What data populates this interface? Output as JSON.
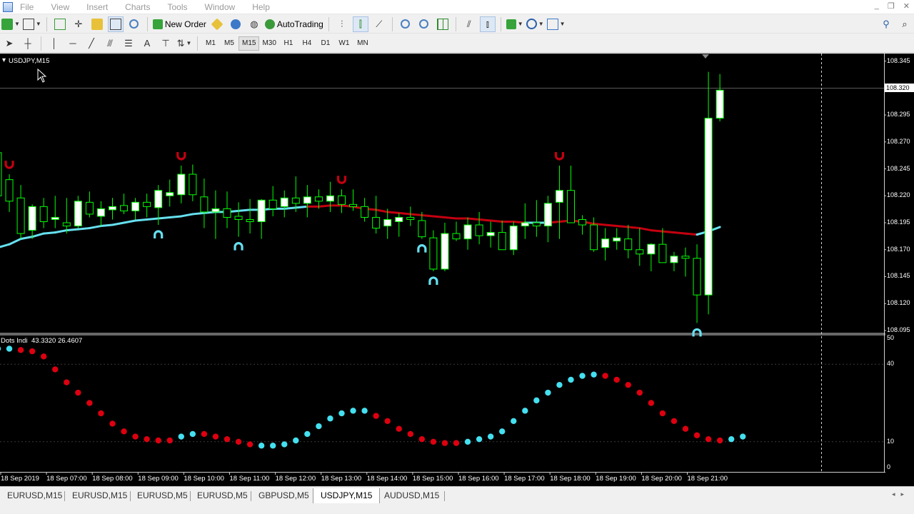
{
  "menu": {
    "items": [
      "File",
      "View",
      "Insert",
      "Charts",
      "Tools",
      "Window",
      "Help"
    ]
  },
  "toolbar": {
    "new_order_label": "New Order",
    "autotrading_label": "AutoTrading",
    "timeframes": [
      "M1",
      "M5",
      "M15",
      "M30",
      "H1",
      "H4",
      "D1",
      "W1",
      "MN"
    ],
    "active_timeframe": "M15"
  },
  "chart": {
    "symbol_label": "USDJPY,M15",
    "current_price": "108.320",
    "price_ticks": [
      "108.345",
      "108.295",
      "108.270",
      "108.245",
      "108.220",
      "108.195",
      "108.170",
      "108.145",
      "108.120",
      "108.095"
    ],
    "indicator_label": "Dots Indi",
    "indicator_values": "43.3320 26.4607",
    "indicator_ticks": [
      "50",
      "40",
      "10",
      "0"
    ],
    "time_ticks": [
      "18 Sep 2019",
      "18 Sep 07:00",
      "18 Sep 08:00",
      "18 Sep 09:00",
      "18 Sep 10:00",
      "18 Sep 11:00",
      "18 Sep 12:00",
      "18 Sep 13:00",
      "18 Sep 14:00",
      "18 Sep 15:00",
      "18 Sep 16:00",
      "18 Sep 17:00",
      "18 Sep 18:00",
      "18 Sep 19:00",
      "18 Sep 20:00",
      "18 Sep 21:00"
    ],
    "colors": {
      "background": "#000000",
      "bull_body": "#ffffff",
      "bear_body": "#000000",
      "candle_wick": "#00ff00",
      "ma_up": "#66e0f0",
      "ma_down": "#c40010",
      "dot_up": "#44e0f0",
      "dot_down": "#dd0010",
      "grid": "#2a4a4a"
    }
  },
  "chart_data": [
    {
      "type": "candlestick",
      "symbol": "USDJPY",
      "timeframe": "M15",
      "ylim": [
        108.093,
        108.352
      ],
      "candles": [
        [
          108.26,
          108.275,
          108.21,
          108.22
        ],
        [
          108.235,
          108.24,
          108.205,
          108.215
        ],
        [
          108.218,
          108.23,
          108.18,
          108.185
        ],
        [
          108.188,
          108.212,
          108.18,
          108.21
        ],
        [
          108.21,
          108.218,
          108.19,
          108.196
        ],
        [
          108.198,
          108.22,
          108.19,
          108.2
        ],
        [
          108.195,
          108.218,
          108.185,
          108.192
        ],
        [
          108.192,
          108.22,
          108.19,
          108.215
        ],
        [
          108.214,
          108.224,
          108.2,
          108.203
        ],
        [
          108.201,
          108.215,
          108.192,
          108.208
        ],
        [
          108.207,
          108.218,
          108.198,
          108.21
        ],
        [
          108.211,
          108.222,
          108.203,
          108.206
        ],
        [
          108.206,
          108.218,
          108.198,
          108.214
        ],
        [
          108.214,
          108.222,
          108.2,
          108.21
        ],
        [
          108.209,
          108.23,
          108.193,
          108.225
        ],
        [
          108.22,
          108.235,
          108.21,
          108.223
        ],
        [
          108.221,
          108.248,
          108.213,
          108.24
        ],
        [
          108.24,
          108.249,
          108.215,
          108.221
        ],
        [
          108.219,
          108.236,
          108.19,
          108.205
        ],
        [
          108.205,
          108.225,
          108.18,
          108.208
        ],
        [
          108.208,
          108.224,
          108.19,
          108.2
        ],
        [
          108.201,
          108.214,
          108.182,
          108.198
        ],
        [
          108.198,
          108.217,
          108.185,
          108.196
        ],
        [
          108.196,
          108.217,
          108.18,
          108.216
        ],
        [
          108.216,
          108.229,
          108.201,
          108.208
        ],
        [
          108.21,
          108.225,
          108.2,
          108.218
        ],
        [
          108.218,
          108.238,
          108.205,
          108.213
        ],
        [
          108.213,
          108.23,
          108.2,
          108.219
        ],
        [
          108.219,
          108.226,
          108.208,
          108.215
        ],
        [
          108.215,
          108.233,
          108.205,
          108.22
        ],
        [
          108.22,
          108.226,
          108.204,
          108.212
        ],
        [
          108.212,
          108.226,
          108.206,
          108.21
        ],
        [
          108.21,
          108.218,
          108.196,
          108.2
        ],
        [
          108.2,
          108.22,
          108.185,
          108.19
        ],
        [
          108.192,
          108.208,
          108.18,
          108.198
        ],
        [
          108.196,
          108.204,
          108.182,
          108.2
        ],
        [
          108.2,
          108.21,
          108.192,
          108.198
        ],
        [
          108.197,
          108.205,
          108.18,
          108.182
        ],
        [
          108.181,
          108.188,
          108.15,
          108.152
        ],
        [
          108.152,
          108.195,
          108.15,
          108.185
        ],
        [
          108.185,
          108.196,
          108.178,
          108.18
        ],
        [
          108.18,
          108.2,
          108.17,
          108.193
        ],
        [
          108.193,
          108.205,
          108.175,
          108.183
        ],
        [
          108.183,
          108.196,
          108.172,
          108.186
        ],
        [
          108.186,
          108.197,
          108.177,
          108.17
        ],
        [
          108.17,
          108.196,
          108.165,
          108.192
        ],
        [
          108.192,
          108.213,
          108.18,
          108.195
        ],
        [
          108.195,
          108.216,
          108.182,
          108.192
        ],
        [
          108.192,
          108.22,
          108.177,
          108.213
        ],
        [
          108.214,
          108.248,
          108.18,
          108.225
        ],
        [
          108.225,
          108.248,
          108.202,
          108.195
        ],
        [
          108.198,
          108.202,
          108.184,
          108.193
        ],
        [
          108.193,
          108.2,
          108.168,
          108.17
        ],
        [
          108.172,
          108.19,
          108.16,
          108.18
        ],
        [
          108.178,
          108.19,
          108.17,
          108.181
        ],
        [
          108.18,
          108.193,
          108.162,
          108.17
        ],
        [
          108.17,
          108.19,
          108.155,
          108.166
        ],
        [
          108.166,
          108.176,
          108.15,
          108.175
        ],
        [
          108.175,
          108.19,
          108.158,
          108.158
        ],
        [
          108.158,
          108.168,
          108.15,
          108.164
        ],
        [
          108.164,
          108.172,
          108.145,
          108.162
        ],
        [
          108.162,
          108.175,
          108.102,
          108.128
        ],
        [
          108.128,
          108.335,
          108.11,
          108.292
        ],
        [
          108.292,
          108.333,
          108.289,
          108.318
        ]
      ],
      "ma_line": [
        108.172,
        108.175,
        108.18,
        108.182,
        108.185,
        108.186,
        108.188,
        108.189,
        108.19,
        108.192,
        108.193,
        108.195,
        108.197,
        108.198,
        108.199,
        108.2,
        108.201,
        108.203,
        108.204,
        108.205,
        108.205,
        108.206,
        108.207,
        108.207,
        108.208,
        108.208,
        108.209,
        108.21,
        108.21,
        108.211,
        108.211,
        108.21,
        108.208,
        108.207,
        108.205,
        108.204,
        108.203,
        108.202,
        108.201,
        108.2,
        108.199,
        108.199,
        108.198,
        108.197,
        108.196,
        108.196,
        108.195,
        108.195,
        108.195,
        108.196,
        108.197,
        108.196,
        108.194,
        108.193,
        108.192,
        108.191,
        108.19,
        108.188,
        108.187,
        108.186,
        108.185,
        108.184,
        108.187,
        108.191
      ],
      "ma_trend": [
        "up",
        "up",
        "up",
        "up",
        "up",
        "up",
        "up",
        "up",
        "up",
        "up",
        "up",
        "up",
        "up",
        "up",
        "up",
        "up",
        "up",
        "up",
        "up",
        "up",
        "up",
        "up",
        "up",
        "up",
        "up",
        "up",
        "up",
        "up",
        "down",
        "down",
        "down",
        "down",
        "down",
        "down",
        "down",
        "down",
        "down",
        "down",
        "down",
        "down",
        "down",
        "down",
        "down",
        "down",
        "down",
        "down",
        "down",
        "up",
        "up",
        "down",
        "down",
        "down",
        "down",
        "down",
        "down",
        "down",
        "down",
        "down",
        "down",
        "down",
        "down",
        "down",
        "up",
        "up"
      ],
      "signals": [
        {
          "candle": 1,
          "kind": "down"
        },
        {
          "candle": 14,
          "kind": "up"
        },
        {
          "candle": 16,
          "kind": "down"
        },
        {
          "candle": 21,
          "kind": "up"
        },
        {
          "candle": 30,
          "kind": "down"
        },
        {
          "candle": 37,
          "kind": "up"
        },
        {
          "candle": 38,
          "kind": "up"
        },
        {
          "candle": 49,
          "kind": "down"
        },
        {
          "candle": 61,
          "kind": "up"
        }
      ]
    },
    {
      "type": "scatter",
      "name": "Dots Indi",
      "ylim": [
        0,
        50
      ],
      "values": [
        46,
        46,
        45.5,
        45,
        43,
        38,
        33,
        29,
        25,
        21,
        17,
        14,
        12,
        11,
        10.5,
        10.5,
        12,
        13,
        13,
        12,
        11,
        10,
        9,
        8.5,
        8.5,
        9,
        10.5,
        13,
        16,
        19,
        21,
        22,
        22,
        20,
        18,
        15,
        13,
        11,
        10,
        9.5,
        9.5,
        10,
        11,
        12,
        14,
        18,
        22,
        26,
        29,
        32,
        34,
        35.5,
        36,
        35.5,
        34,
        32,
        29,
        25,
        21,
        18,
        15,
        12.5,
        11,
        10.5,
        11,
        12
      ],
      "trend": [
        "up",
        "up",
        "down",
        "down",
        "down",
        "down",
        "down",
        "down",
        "down",
        "down",
        "down",
        "down",
        "down",
        "down",
        "down",
        "down",
        "up",
        "up",
        "down",
        "down",
        "down",
        "down",
        "down",
        "up",
        "up",
        "up",
        "up",
        "up",
        "up",
        "up",
        "up",
        "up",
        "up",
        "down",
        "down",
        "down",
        "down",
        "down",
        "down",
        "down",
        "down",
        "up",
        "up",
        "up",
        "up",
        "up",
        "up",
        "up",
        "up",
        "up",
        "up",
        "up",
        "up",
        "down",
        "down",
        "down",
        "down",
        "down",
        "down",
        "down",
        "down",
        "down",
        "down",
        "down",
        "up",
        "up"
      ]
    }
  ],
  "tabs": [
    "EURUSD,M15",
    "EURUSD,M15",
    "EURUSD,M5",
    "EURUSD,M5",
    "GBPUSD,M5",
    "USDJPY,M15",
    "AUDUSD,M15"
  ],
  "active_tab": "USDJPY,M15"
}
